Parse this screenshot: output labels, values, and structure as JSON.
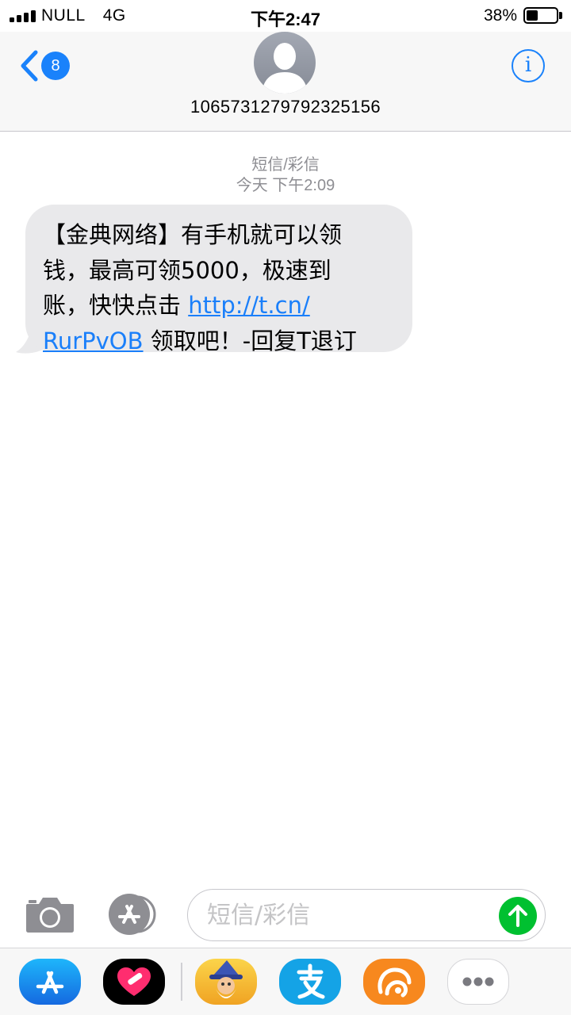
{
  "status_bar": {
    "carrier": "NULL",
    "network": "4G",
    "time": "下午2:47",
    "battery_percent": "38%",
    "battery_level": 0.38
  },
  "header": {
    "back_badge_count": "8",
    "contact": "1065731279792325156"
  },
  "thread": {
    "service_label": "短信/彩信",
    "timestamp": "今天 下午2:09",
    "message": {
      "text_before_link": "【金典网络】有手机就可以领\n钱，最高可领5000，极速到\n账，快快点击 ",
      "link_text": "http://t.cn/\nRurPvOB",
      "text_after_link": " 领取吧！-回复T退订"
    }
  },
  "compose": {
    "placeholder": "短信/彩信"
  },
  "app_drawer": {
    "apps": [
      "app-store",
      "digital-touch",
      "game-wizard",
      "alipay",
      "uc-browser",
      "more"
    ]
  },
  "colors": {
    "accent_blue": "#1a82fb",
    "send_green": "#00c030",
    "bubble_gray": "#e9e9eb",
    "meta_gray": "#8e8e93"
  }
}
